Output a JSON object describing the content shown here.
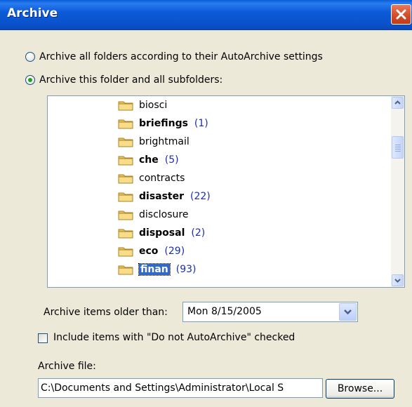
{
  "window": {
    "title": "Archive"
  },
  "options": {
    "archive_all_label": "Archive all folders according to their AutoArchive settings",
    "archive_this_label": "Archive this folder and all subfolders:",
    "selected": "archive_this"
  },
  "folders": [
    {
      "name": "biosci",
      "count": "",
      "bold": false,
      "selected": false
    },
    {
      "name": "briefings",
      "count": "(1)",
      "bold": true,
      "selected": false
    },
    {
      "name": "brightmail",
      "count": "",
      "bold": false,
      "selected": false
    },
    {
      "name": "che",
      "count": "(5)",
      "bold": true,
      "selected": false
    },
    {
      "name": "contracts",
      "count": "",
      "bold": false,
      "selected": false
    },
    {
      "name": "disaster",
      "count": "(22)",
      "bold": true,
      "selected": false
    },
    {
      "name": "disclosure",
      "count": "",
      "bold": false,
      "selected": false
    },
    {
      "name": "disposal",
      "count": "(2)",
      "bold": true,
      "selected": false
    },
    {
      "name": "eco",
      "count": "(29)",
      "bold": true,
      "selected": false
    },
    {
      "name": "finan",
      "count": "(93)",
      "bold": true,
      "selected": true
    }
  ],
  "older_than": {
    "label": "Archive items older than:",
    "value": "Mon 8/15/2005"
  },
  "include_checkbox": {
    "label": "Include items with \"Do not AutoArchive\" checked",
    "checked": false
  },
  "archive_file": {
    "label": "Archive file:",
    "value": "C:\\Documents and Settings\\Administrator\\Local S",
    "browse_label": "Browse..."
  },
  "colors": {
    "titlebar": "#0a52cc",
    "dialog_bg": "#ece9d8",
    "count_text": "#1c2eb0",
    "selection": "#316ac5"
  }
}
